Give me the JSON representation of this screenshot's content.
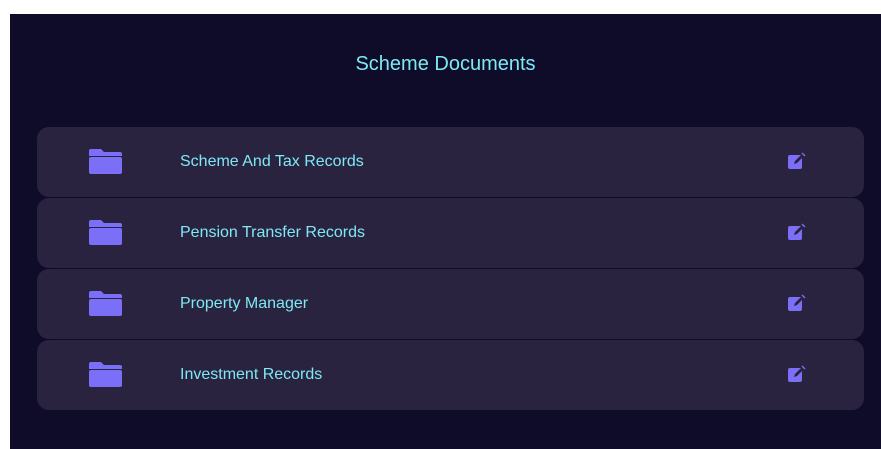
{
  "header": {
    "title": "Scheme Documents"
  },
  "documents": [
    {
      "label": "Scheme And Tax Records",
      "icon": "folder-icon",
      "action_icon": "edit-icon"
    },
    {
      "label": "Pension Transfer Records",
      "icon": "folder-icon",
      "action_icon": "edit-icon"
    },
    {
      "label": "Property Manager",
      "icon": "folder-icon",
      "action_icon": "edit-icon"
    },
    {
      "label": "Investment Records",
      "icon": "folder-icon",
      "action_icon": "edit-icon"
    }
  ],
  "colors": {
    "background": "#0f0c29",
    "row_background": "#29233f",
    "text_accent": "#7ee8f5",
    "icon_accent": "#7b6ff7"
  }
}
